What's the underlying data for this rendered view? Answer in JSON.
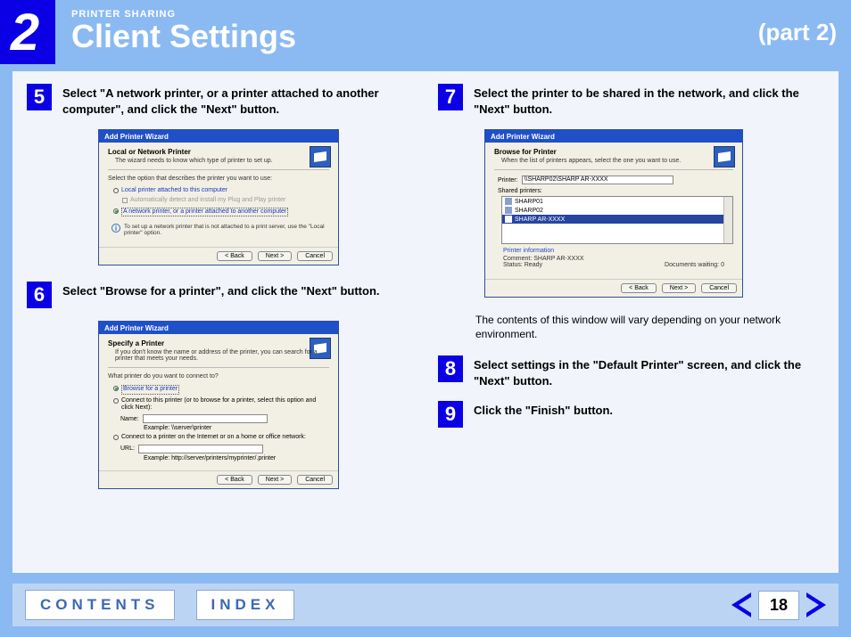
{
  "chapter_number": "2",
  "eyebrow": "PRINTER SHARING",
  "title": "Client Settings",
  "part": "(part 2)",
  "steps": {
    "s5": {
      "num": "5",
      "text": "Select \"A network printer, or a printer attached to another computer\", and click the \"Next\" button."
    },
    "s6": {
      "num": "6",
      "text": "Select \"Browse for a printer\", and click the \"Next\" button."
    },
    "s7": {
      "num": "7",
      "text": "Select the printer to be shared in the network, and click the \"Next\" button."
    },
    "s8": {
      "num": "8",
      "text": "Select settings in the \"Default Printer\" screen, and click the \"Next\" button."
    },
    "s9": {
      "num": "9",
      "text": "Click the \"Finish\" button."
    }
  },
  "wizard": {
    "title": "Add Printer Wizard",
    "a": {
      "heading": "Local or Network Printer",
      "sub": "The wizard needs to know which type of printer to set up.",
      "prompt": "Select the option that describes the printer you want to use:",
      "opt1": "Local printer attached to this computer",
      "opt1_sub": "Automatically detect and install my Plug and Play printer",
      "opt2": "A network printer, or a printer attached to another computer",
      "note": "To set up a network printer that is not attached to a print server, use the \"Local printer\" option."
    },
    "b": {
      "heading": "Specify a Printer",
      "sub": "If you don't know the name or address of the printer, you can search for a printer that meets your needs.",
      "prompt": "What printer do you want to connect to?",
      "opt1": "Browse for a printer",
      "opt2": "Connect to this printer (or to browse for a printer, select this option and click Next):",
      "name_label": "Name:",
      "name_example": "Example: \\\\server\\printer",
      "opt3": "Connect to a printer on the Internet or on a home or office network:",
      "url_label": "URL:",
      "url_example": "Example: http://server/printers/myprinter/.printer"
    },
    "c": {
      "heading": "Browse for Printer",
      "sub": "When the list of printers appears, select the one you want to use.",
      "printer_label": "Printer:",
      "printer_value": "\\\\SHARP02\\SHARP AR-XXXX",
      "shared_label": "Shared printers:",
      "items": [
        "SHARP01",
        "SHARP02",
        "SHARP AR-XXXX"
      ],
      "info_heading": "Printer information",
      "info_comment_label": "Comment:",
      "info_comment_value": "SHARP AR-XXXX",
      "info_docs_label": "Documents waiting:",
      "info_docs_value": "0",
      "info_status_label": "Status:",
      "info_status_value": "Ready"
    },
    "back": "< Back",
    "next": "Next >",
    "cancel": "Cancel"
  },
  "window_note": "The contents of this window will vary depending on your network environment.",
  "footer": {
    "contents": "CONTENTS",
    "index": "INDEX",
    "page": "18"
  }
}
